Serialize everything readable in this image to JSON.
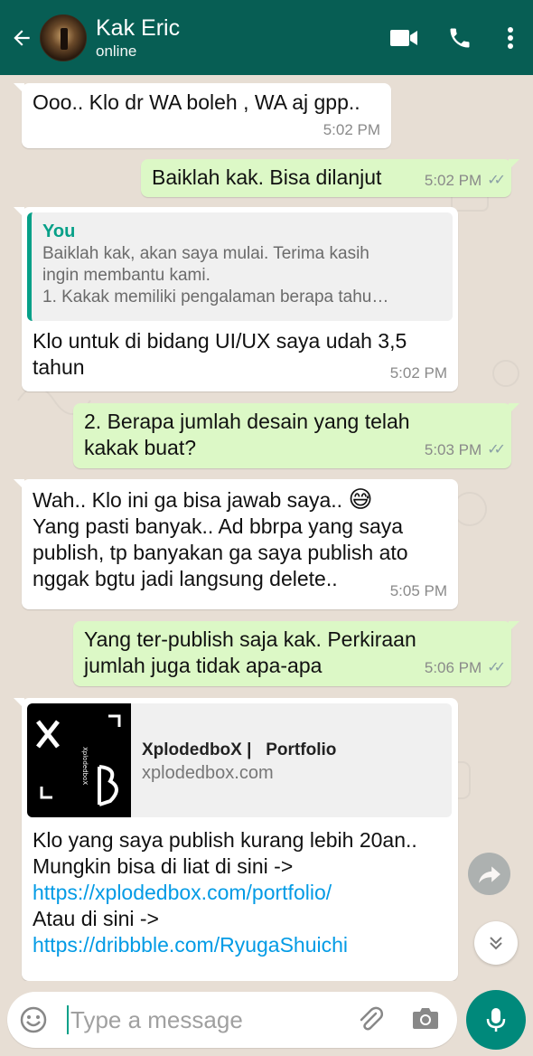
{
  "header": {
    "contact_name": "Kak Eric",
    "status": "online",
    "color": "#075e54"
  },
  "messages": [
    {
      "dir": "in",
      "text": "Ooo.. Klo dr WA boleh , WA aj gpp..",
      "time": "5:02 PM"
    },
    {
      "dir": "out",
      "text": "Baiklah kak. Bisa dilanjut",
      "time": "5:02 PM"
    },
    {
      "dir": "in",
      "quote_author": "You",
      "quote_lines": [
        "Baiklah kak, akan saya mulai. Terima kasih",
        "ingin membantu kami.",
        "1. Kakak memiliki pengalaman berapa tahu…"
      ],
      "lines": [
        "Klo untuk di bidang UI/UX saya udah 3,5",
        "tahun"
      ],
      "time": "5:02 PM"
    },
    {
      "dir": "out",
      "lines": [
        "2. Berapa jumlah desain yang telah",
        "kakak buat?"
      ],
      "time": "5:03 PM"
    },
    {
      "dir": "in",
      "lines": [
        "Wah.. Klo ini ga bisa jawab saya..",
        "Yang pasti banyak.. Ad bbrpa yang saya",
        "publish, tp banyakan ga saya publish ato",
        "nggak bgtu jadi langsung delete.."
      ],
      "emoji": "😅",
      "time": "5:05 PM"
    },
    {
      "dir": "out",
      "lines": [
        "Yang ter-publish saja kak. Perkiraan",
        "jumlah juga tidak apa-apa"
      ],
      "time": "5:06 PM"
    },
    {
      "dir": "in",
      "link_title": "XplodedboX |   Portfolio",
      "link_domain": "xplodedbox.com",
      "thumb_text": "XplodedboX",
      "lines": [
        "Klo yang saya publish kurang lebih 20an..",
        "Mungkin bisa di liat di sini ->",
        "https://xplodedbox.com/portfolio/",
        "Atau di sini ->",
        "https://dribbble.com/RyugaShuichi"
      ]
    }
  ],
  "composer": {
    "placeholder": "Type a message"
  },
  "icons": [
    "back-arrow-icon",
    "video-call-icon",
    "phone-icon",
    "more-vert-icon",
    "forward-icon",
    "scroll-down-icon",
    "emoji-icon",
    "attach-icon",
    "camera-icon",
    "mic-icon"
  ],
  "colors": {
    "incoming": "#ffffff",
    "outgoing": "#dcf8c6",
    "accent": "#06a088",
    "link": "#039be5"
  }
}
